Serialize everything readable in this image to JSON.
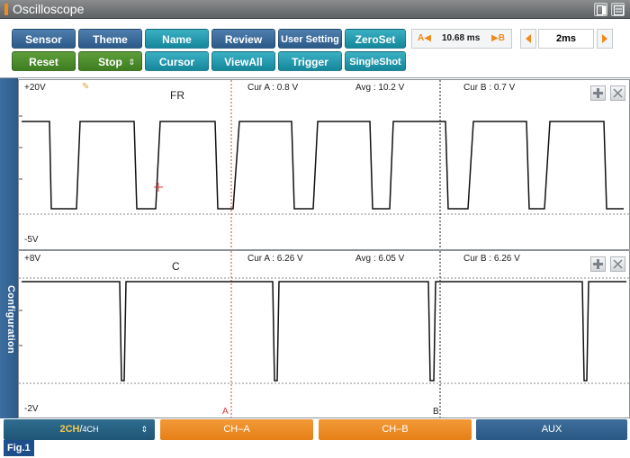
{
  "window": {
    "title": "Oscilloscope"
  },
  "toolbar": {
    "row1": [
      {
        "label": "Sensor",
        "style": "blue"
      },
      {
        "label": "Theme",
        "style": "blue"
      },
      {
        "label": "Name",
        "style": "teal"
      },
      {
        "label": "Review",
        "style": "blue"
      },
      {
        "label": "User Setting",
        "style": "blue"
      },
      {
        "label": "ZeroSet",
        "style": "teal"
      }
    ],
    "row2": [
      {
        "label": "Reset",
        "style": "green"
      },
      {
        "label": "Stop",
        "style": "green"
      },
      {
        "label": "Cursor",
        "style": "teal"
      },
      {
        "label": "ViewAll",
        "style": "teal"
      },
      {
        "label": "Trigger",
        "style": "teal"
      },
      {
        "label": "SingleShot",
        "style": "teal"
      }
    ],
    "cursor_delta": {
      "a_label": "A◀",
      "value": "10.68 ms",
      "b_label": "▶B"
    },
    "time_div": "2ms"
  },
  "side_tab": {
    "label": "Configuration"
  },
  "channels": [
    {
      "name": "FR",
      "v_max": "+20V",
      "v_min": "-5V",
      "cur_a": "Cur A : 0.8 V",
      "avg": "Avg : 10.2 V",
      "cur_b": "Cur B : 0.7 V",
      "high_v": 20,
      "low_v": 0.8
    },
    {
      "name": "C",
      "v_max": "+8V",
      "v_min": "-2V",
      "cur_a": "Cur A : 6.26 V",
      "avg": "Avg : 6.05 V",
      "cur_b": "Cur B : 6.26 V",
      "high_v": 6.26,
      "low_v": 0.0
    }
  ],
  "cursors": {
    "a_label": "A",
    "b_label": "B"
  },
  "bottom_tabs": {
    "ch_mode_hi": "2CH",
    "ch_mode_sep": "/",
    "ch_mode_lo": "4CH",
    "ch_a": "CH–A",
    "ch_b": "CH–B",
    "aux": "AUX"
  },
  "figure_label": "Fig.1",
  "colors": {
    "accent_orange": "#f08a1c",
    "button_blue": "#2c5a88",
    "button_teal": "#15879b",
    "button_green": "#3f7d22",
    "cursor_a": "#e0383b",
    "cursor_b": "#222222"
  }
}
